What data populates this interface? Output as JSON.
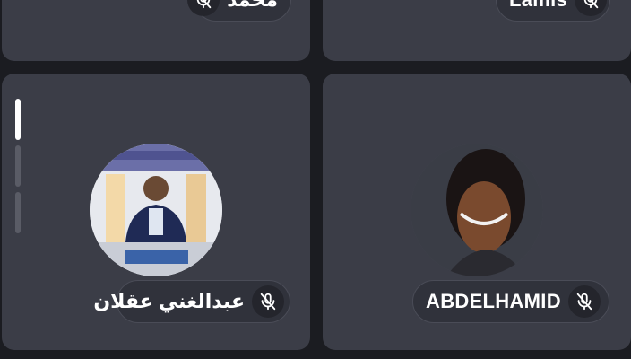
{
  "participants": [
    {
      "name": "محمد",
      "muted": true
    },
    {
      "name": "Lamis",
      "muted": true
    },
    {
      "name": "عبدالغني عقلان",
      "muted": true,
      "audio_level_active_bars": 1,
      "audio_level_total_bars": 3
    },
    {
      "name": "ABDELHAMID",
      "muted": true
    }
  ],
  "icons": {
    "mic": "mic-off-icon"
  },
  "colors": {
    "background": "#1b1c21",
    "tile": "#3b3d47",
    "pill": "#30323b",
    "text": "#ffffff",
    "level_active": "#ffffff",
    "level_inactive": "#5a5c66"
  }
}
